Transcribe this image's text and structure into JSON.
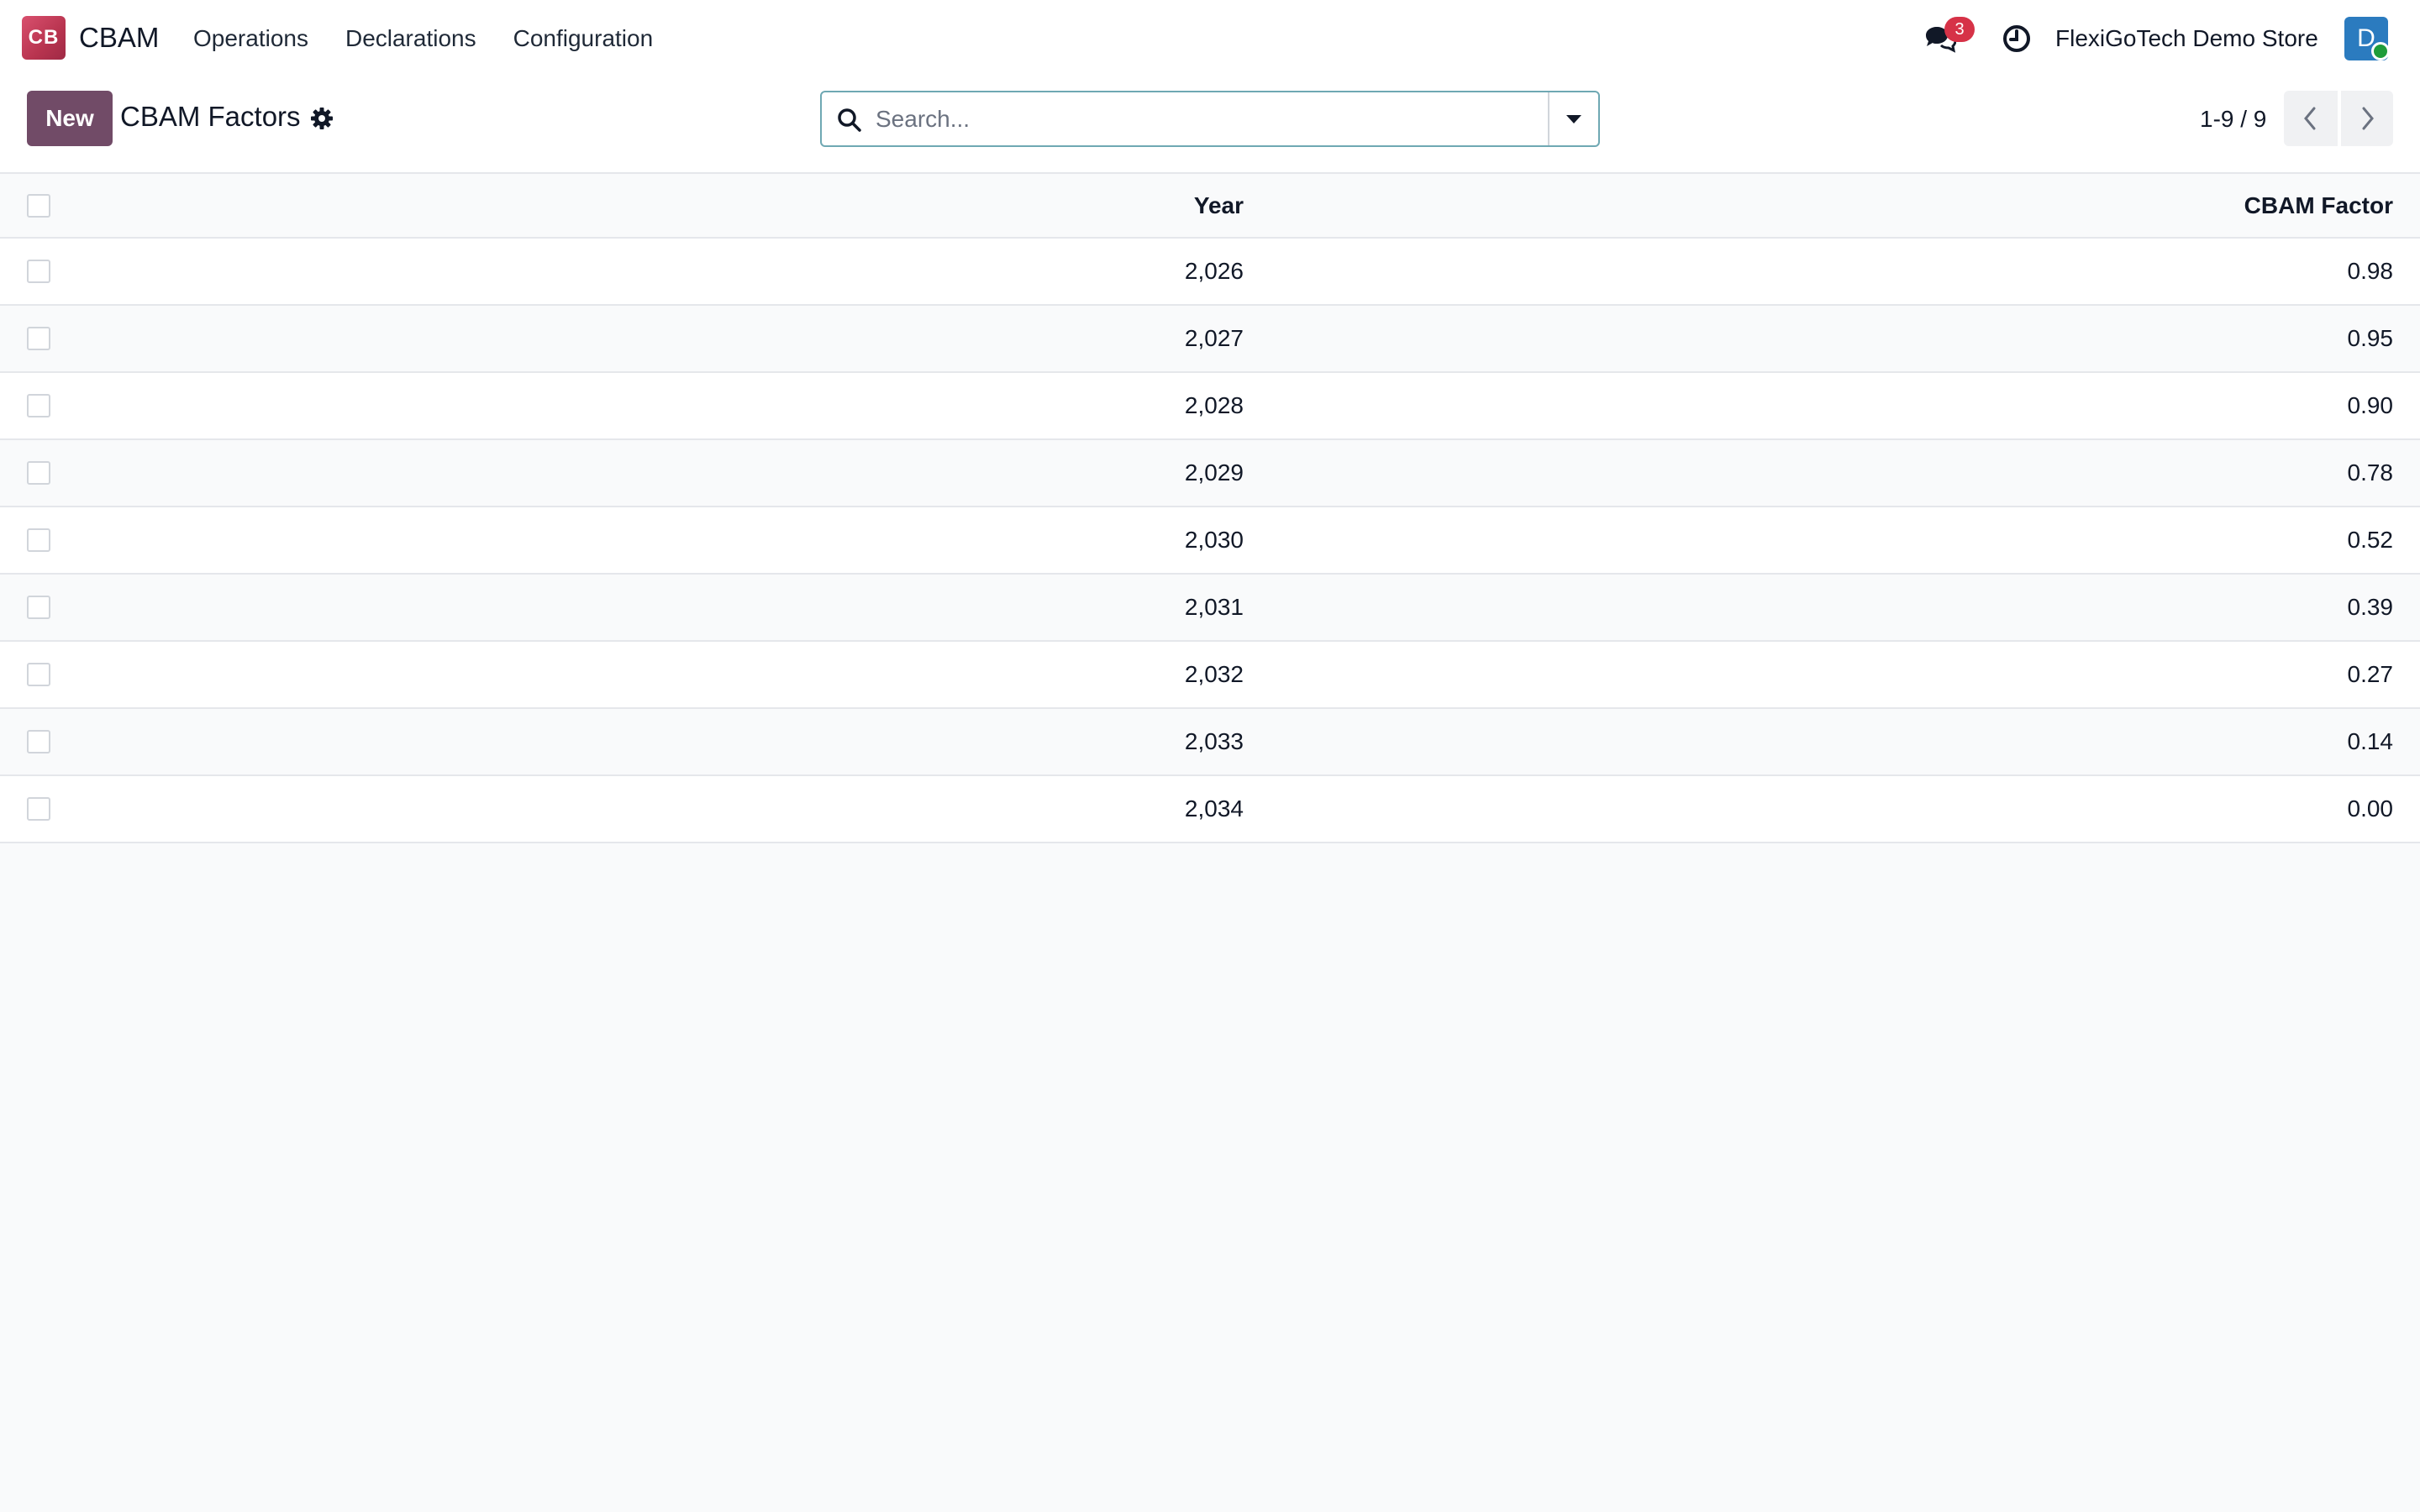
{
  "navbar": {
    "logo_text": "CB",
    "app_name": "CBAM",
    "menu": [
      "Operations",
      "Declarations",
      "Configuration"
    ],
    "messages_badge": "3",
    "company_name": "FlexiGoTech Demo Store",
    "avatar_initial": "D"
  },
  "control_panel": {
    "new_label": "New",
    "title": "CBAM Factors",
    "search_placeholder": "Search...",
    "pager": "1-9 / 9"
  },
  "table": {
    "columns": [
      "Year",
      "CBAM Factor"
    ],
    "rows": [
      {
        "year": "2,026",
        "factor": "0.98"
      },
      {
        "year": "2,027",
        "factor": "0.95"
      },
      {
        "year": "2,028",
        "factor": "0.90"
      },
      {
        "year": "2,029",
        "factor": "0.78"
      },
      {
        "year": "2,030",
        "factor": "0.52"
      },
      {
        "year": "2,031",
        "factor": "0.39"
      },
      {
        "year": "2,032",
        "factor": "0.27"
      },
      {
        "year": "2,033",
        "factor": "0.14"
      },
      {
        "year": "2,034",
        "factor": "0.00"
      }
    ]
  },
  "colors": {
    "primary": "#714b67",
    "badge": "#d63247",
    "avatar": "#2b7bbf",
    "presence": "#1f9c3a"
  }
}
